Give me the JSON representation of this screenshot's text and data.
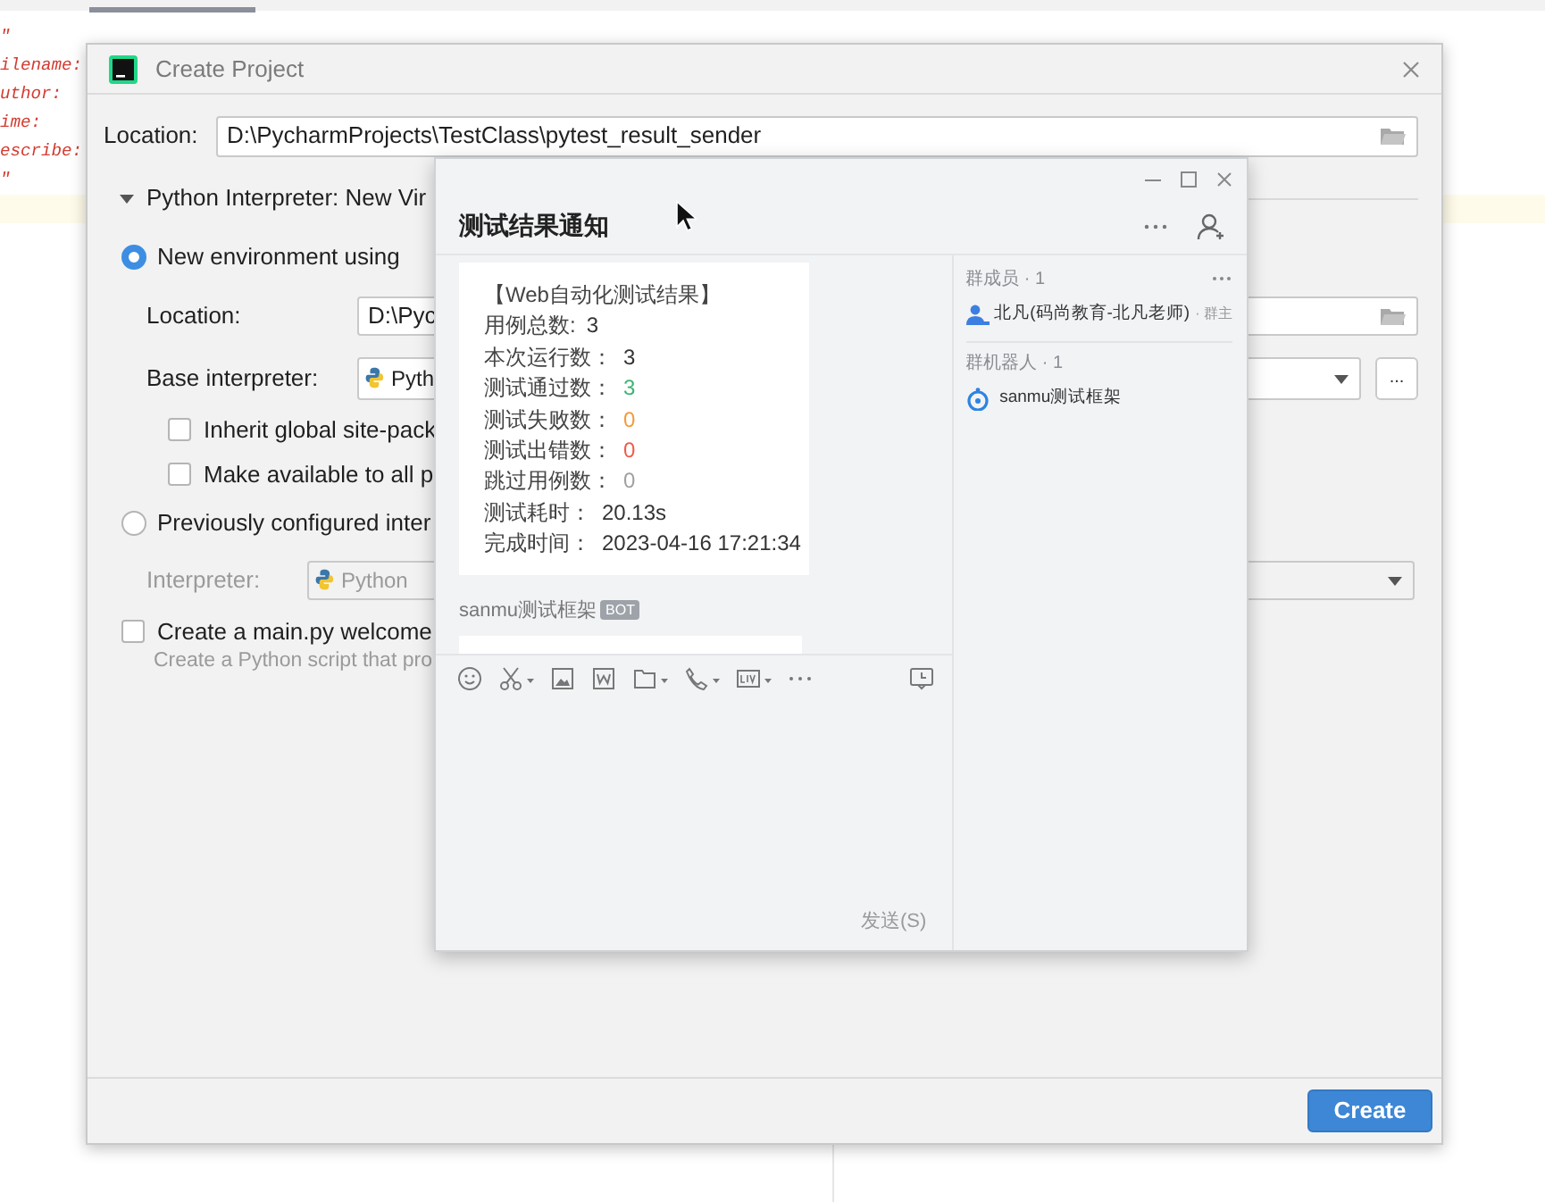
{
  "editor": {
    "lines": [
      {
        "text": "\""
      },
      {
        "text": "ilename:"
      },
      {
        "text": "uthor:"
      },
      {
        "text": "ime:"
      },
      {
        "text": "escribe:"
      },
      {
        "text": "\""
      }
    ]
  },
  "dialog": {
    "title": "Create Project",
    "location_label": "Location:",
    "location_value": "D:\\PycharmProjects\\TestClass\\pytest_result_sender",
    "section": {
      "label": "Python Interpreter: New Vir",
      "expanded": true
    },
    "rows": [
      {
        "kind": "radio",
        "label": "New environment using",
        "selected": true
      },
      {
        "kind": "field",
        "label": "Location:",
        "value": "D:\\Pyc"
      },
      {
        "kind": "dropdown",
        "label": "Base interpreter:",
        "value": "Pyth",
        "disabled": false,
        "more_label": "..."
      },
      {
        "kind": "checkbox",
        "label": "Inherit global site-pack",
        "checked": false
      },
      {
        "kind": "checkbox",
        "label": "Make available to all p",
        "checked": false
      },
      {
        "kind": "radio",
        "label": "Previously configured inter",
        "selected": false
      },
      {
        "kind": "dropdown",
        "label": "Interpreter:",
        "value": "Python",
        "disabled": true
      },
      {
        "kind": "checkbox",
        "label": "Create a main.py welcome",
        "checked": false,
        "hint": "Create a Python script that pro"
      }
    ],
    "button": "Create"
  },
  "chat": {
    "title": "测试结果通知",
    "message": {
      "heading": "【Web自动化测试结果】",
      "rows": [
        {
          "label": "用例总数:",
          "value": "3",
          "color": "#333333"
        },
        {
          "label": "本次运行数：",
          "value": "3",
          "color": "#333333"
        },
        {
          "label": "测试通过数：",
          "value": "3",
          "color": "#3cb371"
        },
        {
          "label": "测试失败数：",
          "value": "0",
          "color": "#f39a3a"
        },
        {
          "label": "测试出错数：",
          "value": "0",
          "color": "#ef5b4c"
        },
        {
          "label": "跳过用例数：",
          "value": "0",
          "color": "#a0a0a0"
        },
        {
          "label": "测试耗时：",
          "value": "20.13s",
          "color": "#333333"
        },
        {
          "label": "完成时间：",
          "value": "2023-04-16 17:21:34",
          "color": "#333333"
        }
      ]
    },
    "sender": {
      "name": "sanmu测试框架",
      "badge": "BOT"
    },
    "send": "发送(S)",
    "members": {
      "header": "群成员 · 1",
      "items": [
        {
          "name": "北凡(码尚教育-北凡老师)",
          "role": "· 群主"
        }
      ]
    },
    "robots": {
      "header": "群机器人 · 1",
      "items": [
        {
          "name": "sanmu测试框架"
        }
      ]
    }
  }
}
